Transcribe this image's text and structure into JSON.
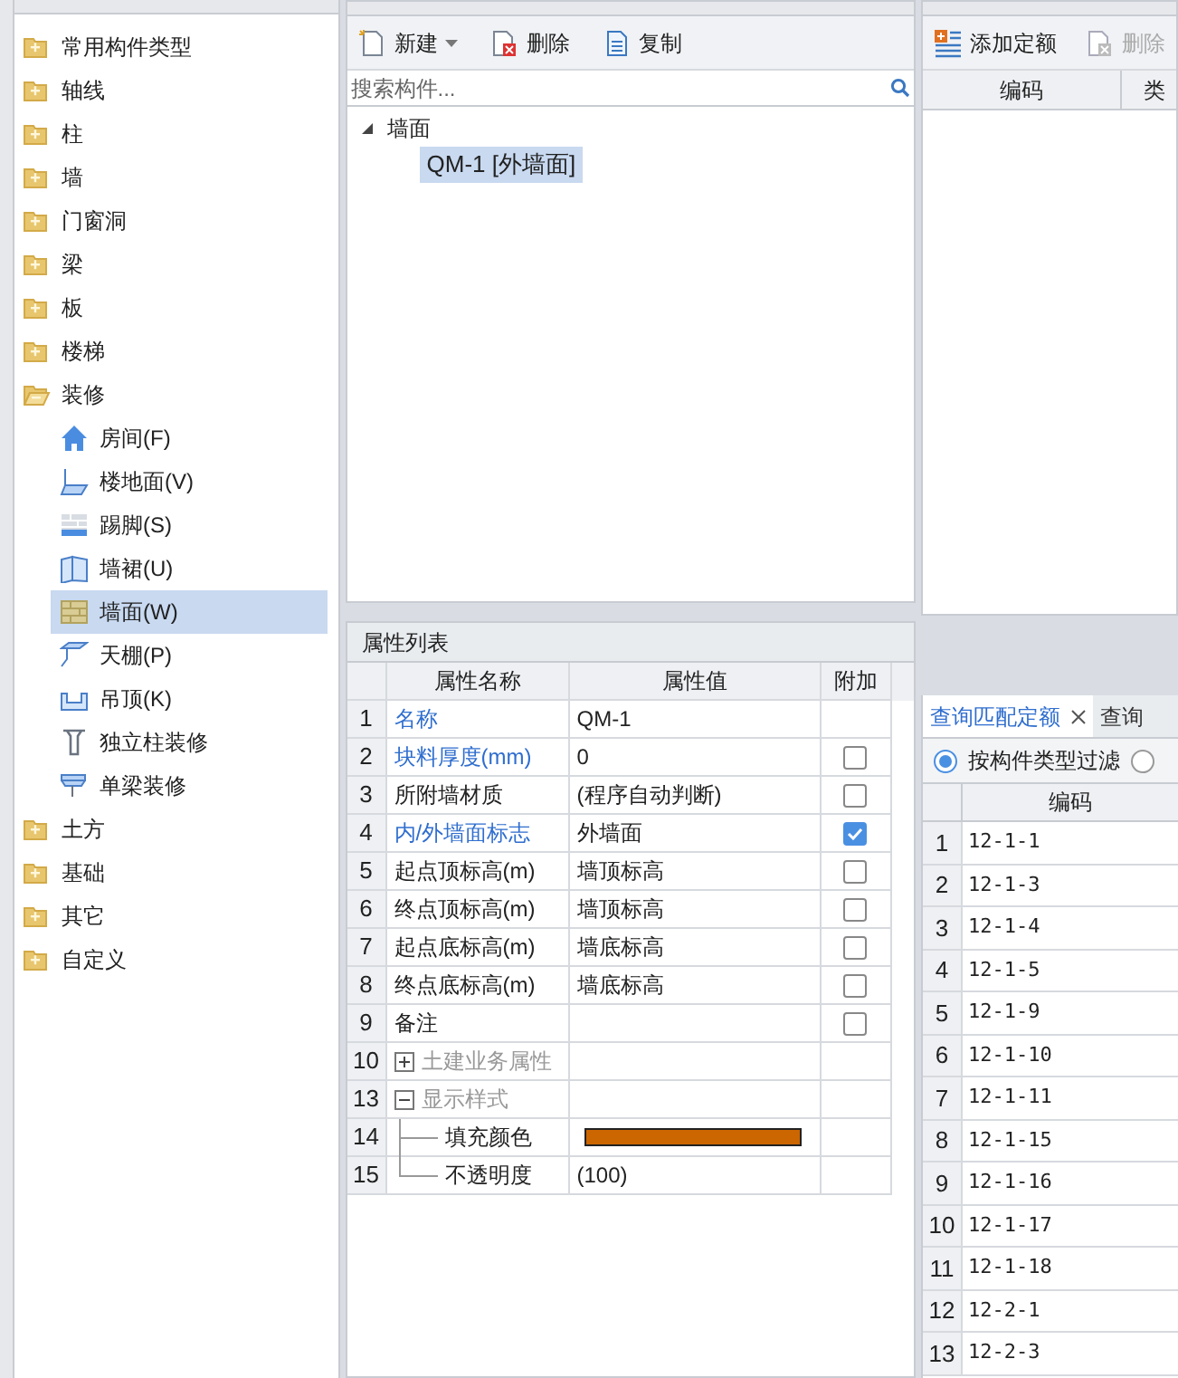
{
  "nav_tree": {
    "items": [
      {
        "label": "常用构件类型",
        "expanded": false
      },
      {
        "label": "轴线",
        "expanded": false
      },
      {
        "label": "柱",
        "expanded": false
      },
      {
        "label": "墙",
        "expanded": false
      },
      {
        "label": "门窗洞",
        "expanded": false
      },
      {
        "label": "梁",
        "expanded": false
      },
      {
        "label": "板",
        "expanded": false
      },
      {
        "label": "楼梯",
        "expanded": false
      },
      {
        "label": "装修",
        "expanded": true,
        "children": [
          {
            "label": "房间(F)",
            "selected": false
          },
          {
            "label": "楼地面(V)",
            "selected": false
          },
          {
            "label": "踢脚(S)",
            "selected": false
          },
          {
            "label": "墙裙(U)",
            "selected": false
          },
          {
            "label": "墙面(W)",
            "selected": true
          },
          {
            "label": "天棚(P)",
            "selected": false
          },
          {
            "label": "吊顶(K)",
            "selected": false
          },
          {
            "label": "独立柱装修",
            "selected": false
          },
          {
            "label": "单梁装修",
            "selected": false
          }
        ]
      },
      {
        "label": "土方",
        "expanded": false
      },
      {
        "label": "基础",
        "expanded": false
      },
      {
        "label": "其它",
        "expanded": false
      },
      {
        "label": "自定义",
        "expanded": false
      }
    ]
  },
  "component_list": {
    "toolbar": [
      {
        "label": "新建",
        "dropdown": true
      },
      {
        "label": "删除",
        "dropdown": false
      },
      {
        "label": "复制",
        "dropdown": false
      }
    ],
    "search": {
      "placeholder": "搜索构件..."
    },
    "tree": {
      "label": "墙面",
      "expanded": true,
      "children": [
        {
          "label": "QM-1 [外墙面]",
          "selected": true
        }
      ]
    }
  },
  "properties": {
    "title": "属性列表",
    "columns": [
      "属性名称",
      "属性值",
      "附加"
    ],
    "rows": [
      {
        "index": "1",
        "kind": "field",
        "name": "名称",
        "highlighted": true,
        "value": "QM-1"
      },
      {
        "index": "2",
        "kind": "field",
        "name": "块料厚度(mm)",
        "highlighted": true,
        "value": "0",
        "checked": false
      },
      {
        "index": "3",
        "kind": "field",
        "name": "所附墙材质",
        "highlighted": false,
        "value": "(程序自动判断)",
        "checked": false
      },
      {
        "index": "4",
        "kind": "field",
        "name": "内/外墙面标志",
        "highlighted": true,
        "value": "外墙面",
        "checked": true
      },
      {
        "index": "5",
        "kind": "field",
        "name": "起点顶标高(m)",
        "highlighted": false,
        "value": "墙顶标高",
        "checked": false
      },
      {
        "index": "6",
        "kind": "field",
        "name": "终点顶标高(m)",
        "highlighted": false,
        "value": "墙顶标高",
        "checked": false
      },
      {
        "index": "7",
        "kind": "field",
        "name": "起点底标高(m)",
        "highlighted": false,
        "value": "墙底标高",
        "checked": false
      },
      {
        "index": "8",
        "kind": "field",
        "name": "终点底标高(m)",
        "highlighted": false,
        "value": "墙底标高",
        "checked": false
      },
      {
        "index": "9",
        "kind": "field",
        "name": "备注",
        "highlighted": false,
        "value": "",
        "checked": false
      },
      {
        "index": "10",
        "kind": "group",
        "name": "土建业务属性",
        "expanded": false
      },
      {
        "index": "13",
        "kind": "group",
        "name": "显示样式",
        "expanded": true
      },
      {
        "index": "14",
        "kind": "child",
        "name": "填充颜色",
        "color": "#cc6600"
      },
      {
        "index": "15",
        "kind": "child",
        "name": "不透明度",
        "value": "(100)",
        "last": true
      }
    ]
  },
  "component_method": {
    "toolbar": [
      {
        "label": "添加定额",
        "disabled": false
      },
      {
        "label": "删除",
        "disabled": true
      }
    ],
    "columns": [
      "编码",
      "类"
    ]
  },
  "quota_query": {
    "tabs": [
      {
        "label": "查询匹配定额",
        "selected": true,
        "closable": true
      },
      {
        "label": "查询",
        "selected": false,
        "closable": false
      }
    ],
    "filters": [
      {
        "label": "按构件类型过滤",
        "selected": true
      },
      {
        "selected": false
      }
    ],
    "column": "编码",
    "rows": [
      {
        "index": "1",
        "code": "12-1-1"
      },
      {
        "index": "2",
        "code": "12-1-3"
      },
      {
        "index": "3",
        "code": "12-1-4"
      },
      {
        "index": "4",
        "code": "12-1-5"
      },
      {
        "index": "5",
        "code": "12-1-9"
      },
      {
        "index": "6",
        "code": "12-1-10"
      },
      {
        "index": "7",
        "code": "12-1-11"
      },
      {
        "index": "8",
        "code": "12-1-15"
      },
      {
        "index": "9",
        "code": "12-1-16"
      },
      {
        "index": "10",
        "code": "12-1-17"
      },
      {
        "index": "11",
        "code": "12-1-18"
      },
      {
        "index": "12",
        "code": "12-2-1"
      },
      {
        "index": "13",
        "code": "12-2-3"
      }
    ]
  }
}
